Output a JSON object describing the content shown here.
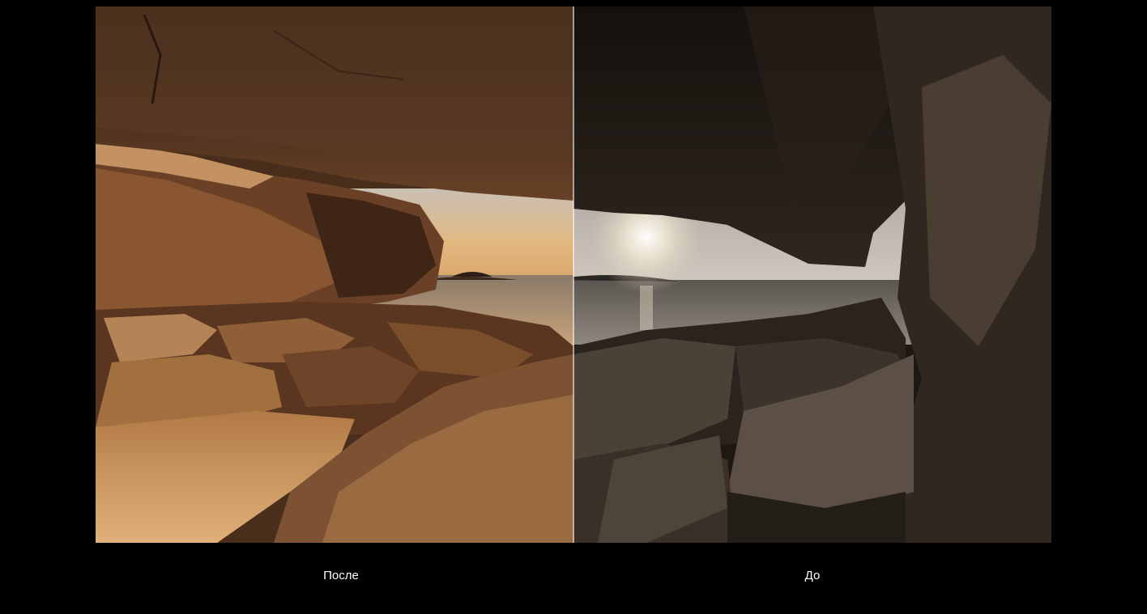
{
  "comparison": {
    "after_label": "После",
    "before_label": "До",
    "after_image": "sea-cave-sunset-edited",
    "before_image": "sea-cave-sunset-original",
    "split_position_percent": 50
  },
  "colors": {
    "page_background": "#000000",
    "label_text": "#ffffff",
    "divider": "#ffffff"
  }
}
